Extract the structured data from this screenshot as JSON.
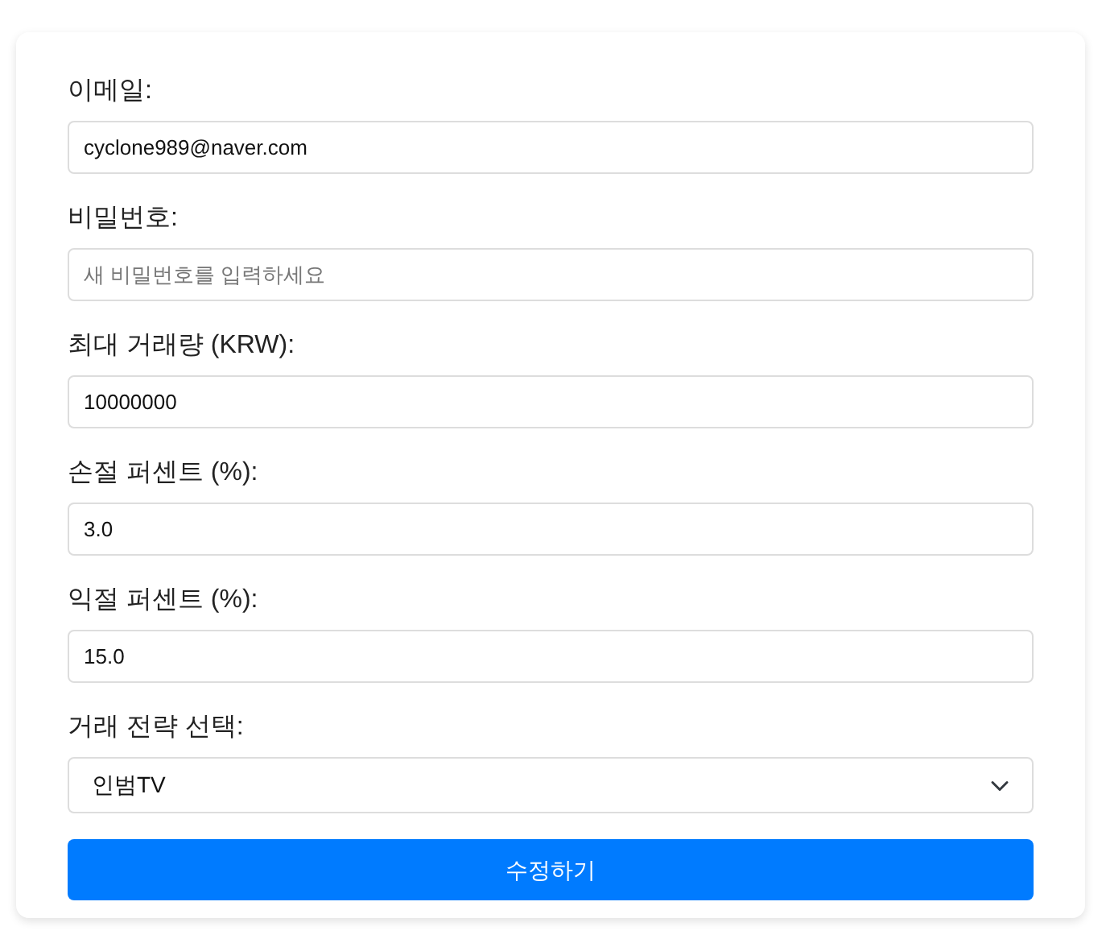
{
  "fields": [
    {
      "kind": "input",
      "label": "이메일:",
      "value": "cyclone989@naver.com"
    },
    {
      "kind": "input",
      "label": "비밀번호:",
      "placeholder": "새 비밀번호를 입력하세요"
    },
    {
      "kind": "input",
      "label": "최대 거래량 (KRW):",
      "value": "10000000"
    },
    {
      "kind": "input",
      "label": "손절 퍼센트 (%):",
      "value": "3.0"
    },
    {
      "kind": "input",
      "label": "익절 퍼센트 (%):",
      "value": "15.0"
    },
    {
      "kind": "select",
      "label": "거래 전략 선택:",
      "value": "인범TV"
    }
  ],
  "submit": "수정하기"
}
